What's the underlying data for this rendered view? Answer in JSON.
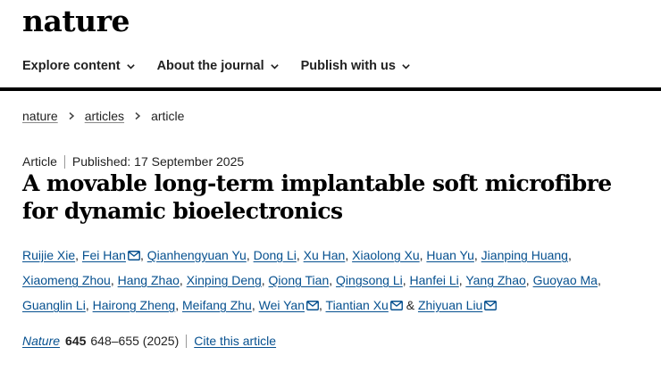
{
  "site": {
    "logo": "nature"
  },
  "nav": {
    "items": [
      {
        "label": "Explore content"
      },
      {
        "label": "About the journal"
      },
      {
        "label": "Publish with us"
      }
    ]
  },
  "breadcrumb": {
    "items": [
      "nature",
      "articles",
      "article"
    ]
  },
  "article": {
    "type": "Article",
    "published": "Published: 17 September 2025",
    "title": "A movable long-term implantable soft microfibre for dynamic bioelectronics",
    "authors": [
      {
        "name": "Ruijie Xie"
      },
      {
        "name": "Fei Han",
        "email": true
      },
      {
        "name": "Qianhengyuan Yu"
      },
      {
        "name": "Dong Li"
      },
      {
        "name": "Xu Han"
      },
      {
        "name": "Xiaolong Xu"
      },
      {
        "name": "Huan Yu"
      },
      {
        "name": "Jianping Huang"
      },
      {
        "name": "Xiaomeng Zhou"
      },
      {
        "name": "Hang Zhao"
      },
      {
        "name": "Xinping Deng"
      },
      {
        "name": "Qiong Tian"
      },
      {
        "name": "Qingsong Li"
      },
      {
        "name": "Hanfei Li"
      },
      {
        "name": "Yang Zhao"
      },
      {
        "name": "Guoyao Ma"
      },
      {
        "name": "Guanglin Li"
      },
      {
        "name": "Hairong Zheng"
      },
      {
        "name": "Meifang Zhu"
      },
      {
        "name": "Wei Yan",
        "email": true
      },
      {
        "name": "Tiantian Xu",
        "email": true
      },
      {
        "name": "Zhiyuan Liu",
        "email": true
      }
    ],
    "journal": "Nature",
    "volume": "645",
    "pages": "648–655 (2025)",
    "cite_label": "Cite this article"
  },
  "colors": {
    "link": "#06508f",
    "rule": "#000000",
    "text": "#222222"
  },
  "icons": {
    "nav_dropdown": "chevron-down-icon",
    "breadcrumb_sep": "chevron-right-icon",
    "author_email": "mail-icon"
  }
}
